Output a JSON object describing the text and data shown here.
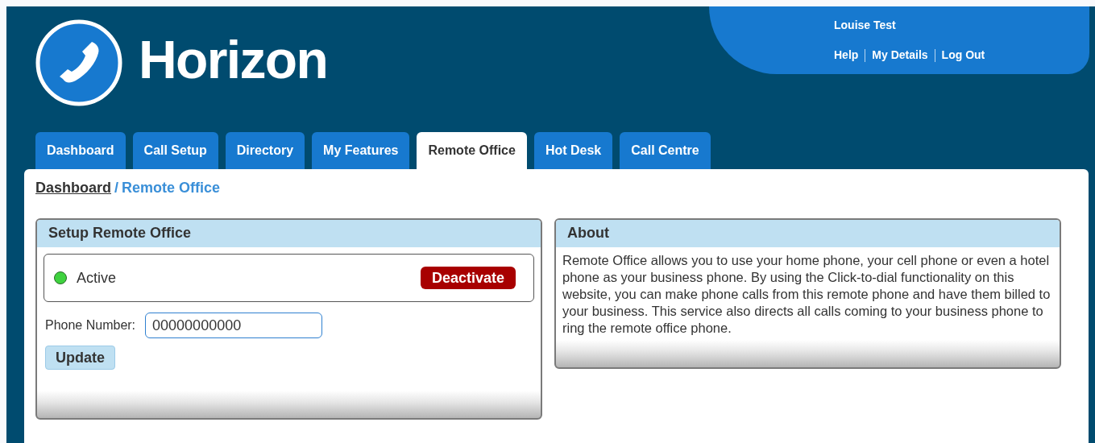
{
  "brand": {
    "title": "Horizon"
  },
  "user": {
    "name": "Louise Test",
    "links": [
      "Help",
      "My Details",
      "Log Out"
    ]
  },
  "tabs": [
    {
      "label": "Dashboard",
      "selected": false
    },
    {
      "label": "Call Setup",
      "selected": false
    },
    {
      "label": "Directory",
      "selected": false
    },
    {
      "label": "My Features",
      "selected": false
    },
    {
      "label": "Remote Office",
      "selected": true
    },
    {
      "label": "Hot Desk",
      "selected": false
    },
    {
      "label": "Call Centre",
      "selected": false
    }
  ],
  "breadcrumb": {
    "parent": "Dashboard",
    "separator": "/",
    "current": "Remote Office"
  },
  "setup_panel": {
    "title": "Setup Remote Office",
    "status": {
      "label": "Active",
      "active": true
    },
    "action_button": "Deactivate",
    "phone_label": "Phone Number:",
    "phone_value": "00000000000",
    "update_button": "Update"
  },
  "about_panel": {
    "title": "About",
    "text": "Remote Office allows you to use your home phone, your cell phone or even a hotel phone as your business phone. By using the Click-to-dial functionality on this website, you can make phone calls from this remote phone and have them billed to your business. This service also directs all calls coming to your business phone to ring the remote office phone."
  }
}
